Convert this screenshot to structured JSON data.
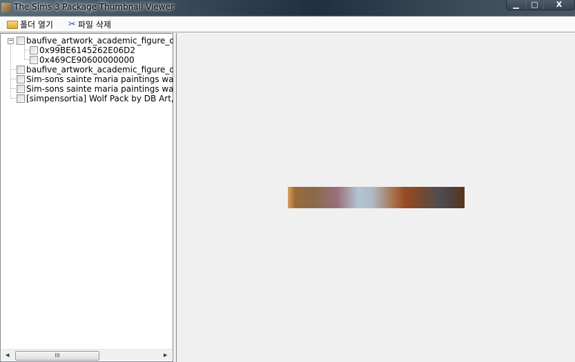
{
  "window": {
    "title": "The Sims 3 Package Thumbnail Viewer",
    "minimize": "▁",
    "maximize": "□",
    "close": "X"
  },
  "toolbar": {
    "open_folder": "폴더 열기",
    "delete_file": "파일 삭제"
  },
  "tree": {
    "nodes": [
      {
        "label": "baufive_artwork_academic_figure_dra",
        "children": [
          "0x99BE6145262E06D2",
          "0x469CE90600000000"
        ],
        "expanded": true
      },
      {
        "label": "baufive_artwork_academic_figure_dra"
      },
      {
        "label": "Sim-sons sainte maria paintings wal"
      },
      {
        "label": "Sim-sons sainte maria paintings wal"
      },
      {
        "label": "[simpensortia] Wolf Pack by DB Art,p"
      }
    ],
    "expander_minus": "−",
    "scroll_thumb": "III",
    "scroll_left": "◀",
    "scroll_right": "▶"
  }
}
